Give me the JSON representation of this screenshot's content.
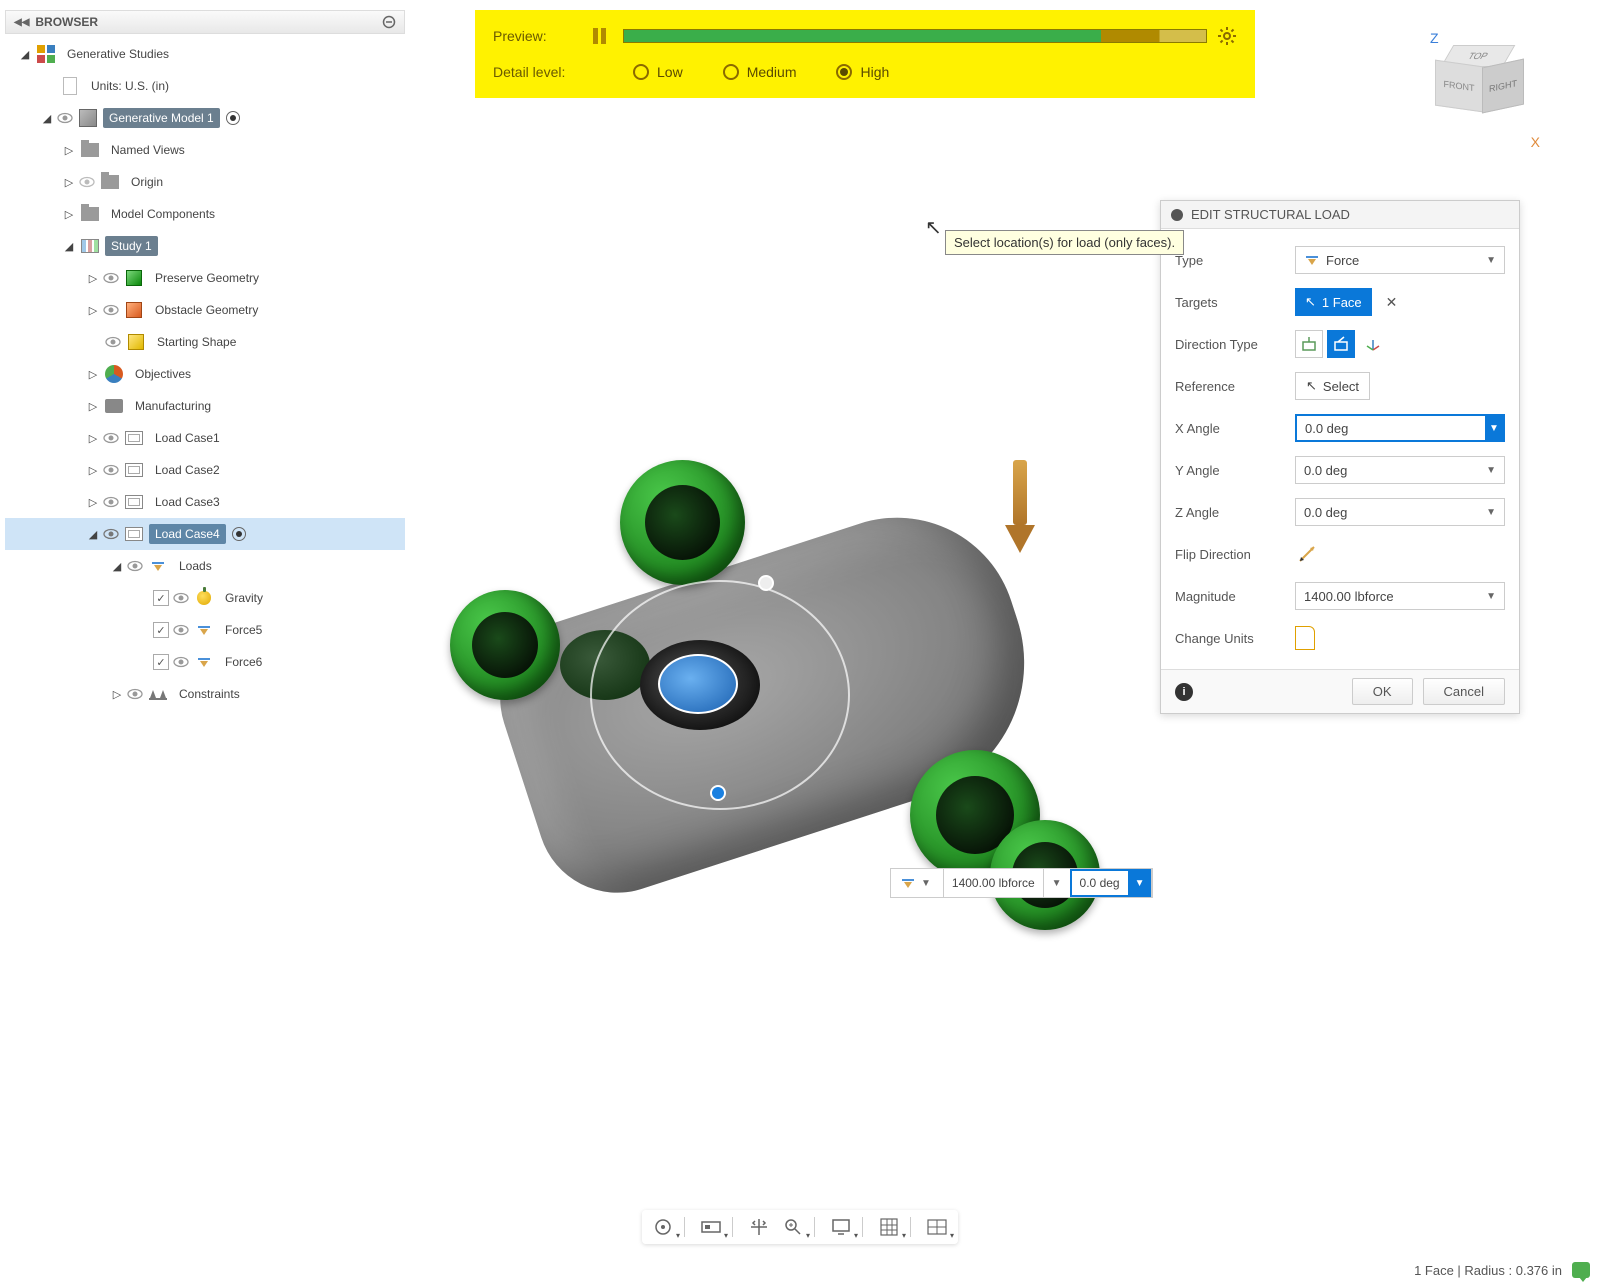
{
  "browser": {
    "title": "BROWSER",
    "tree": {
      "root": "Generative Studies",
      "units": "Units: U.S. (in)",
      "model": "Generative Model 1",
      "named_views": "Named Views",
      "origin": "Origin",
      "components": "Model Components",
      "study": "Study 1",
      "preserve": "Preserve Geometry",
      "obstacle": "Obstacle Geometry",
      "starting": "Starting Shape",
      "objectives": "Objectives",
      "manufacturing": "Manufacturing",
      "lc1": "Load Case1",
      "lc2": "Load Case2",
      "lc3": "Load Case3",
      "lc4": "Load Case4",
      "loads": "Loads",
      "gravity": "Gravity",
      "force5": "Force5",
      "force6": "Force6",
      "constraints": "Constraints"
    }
  },
  "preview": {
    "label": "Preview:",
    "detail_label": "Detail level:",
    "low": "Low",
    "medium": "Medium",
    "high": "High"
  },
  "viewcube": {
    "top": "TOP",
    "front": "FRONT",
    "right": "RIGHT",
    "z": "Z",
    "x": "X"
  },
  "tooltip": "Select location(s) for load (only faces).",
  "edit": {
    "title": "EDIT STRUCTURAL LOAD",
    "type_label": "Type",
    "type_value": "Force",
    "targets_label": "Targets",
    "targets_value": "1 Face",
    "direction_label": "Direction Type",
    "reference_label": "Reference",
    "reference_value": "Select",
    "x_label": "X Angle",
    "x_value": "0.0 deg",
    "y_label": "Y Angle",
    "y_value": "0.0 deg",
    "z_label": "Z Angle",
    "z_value": "0.0 deg",
    "flip_label": "Flip Direction",
    "mag_label": "Magnitude",
    "mag_value": "1400.00 lbforce",
    "units_label": "Change Units",
    "ok": "OK",
    "cancel": "Cancel"
  },
  "hud": {
    "mag": "1400.00 lbforce",
    "angle": "0.0 deg"
  },
  "status": "1 Face | Radius : 0.376 in"
}
